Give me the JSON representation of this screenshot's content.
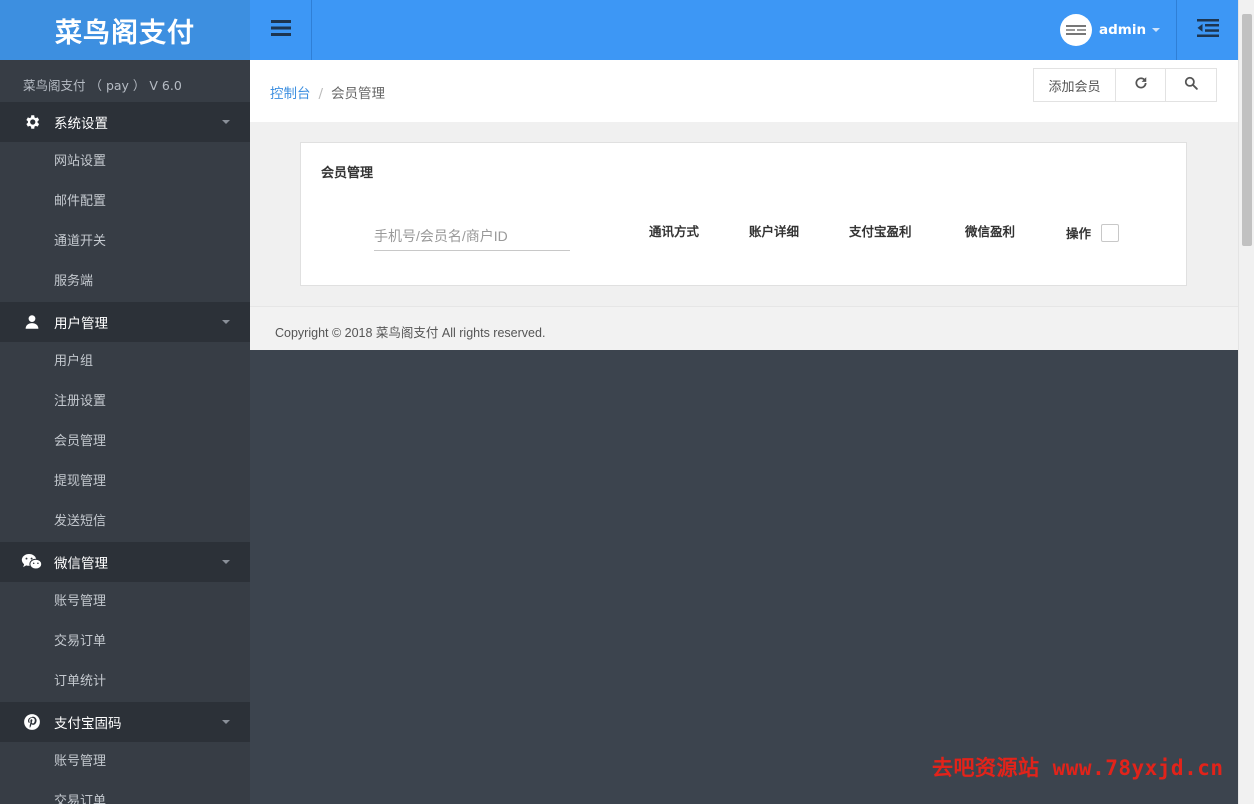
{
  "app": {
    "brand": "菜鸟阁支付",
    "version_line": "菜鸟阁支付 （ pay ） V 6.0"
  },
  "sidebar": {
    "groups": [
      {
        "label": "系统设置",
        "icon": "gear-icon",
        "items": [
          "网站设置",
          "邮件配置",
          "通道开关",
          "服务端"
        ]
      },
      {
        "label": "用户管理",
        "icon": "user-icon",
        "items": [
          "用户组",
          "注册设置",
          "会员管理",
          "提现管理",
          "发送短信"
        ]
      },
      {
        "label": "微信管理",
        "icon": "wechat-icon",
        "items": [
          "账号管理",
          "交易订单",
          "订单统计"
        ]
      },
      {
        "label": "支付宝固码",
        "icon": "pinterest-icon",
        "items": [
          "账号管理",
          "交易订单"
        ]
      }
    ]
  },
  "header": {
    "username": "admin"
  },
  "breadcrumb": {
    "home": "控制台",
    "separator": "/",
    "current": "会员管理"
  },
  "toolbar": {
    "add_label": "添加会员"
  },
  "panel": {
    "title": "会员管理",
    "search_placeholder": "手机号/会员名/商户ID",
    "columns": [
      "通讯方式",
      "账户详细",
      "支付宝盈利",
      "微信盈利"
    ],
    "op_label": "操作"
  },
  "footer": {
    "copyright": "Copyright © 2018 菜鸟阁支付 All rights reserved."
  },
  "watermark": "去吧资源站 www.78yxjd.cn",
  "colors": {
    "brand_bg": "#3d8fe0",
    "topbar_bg": "#3d97f5",
    "sidebar_bg": "#373d45",
    "group_bg": "#2c3138",
    "link": "#3d8fe0",
    "watermark": "#e2231a"
  }
}
